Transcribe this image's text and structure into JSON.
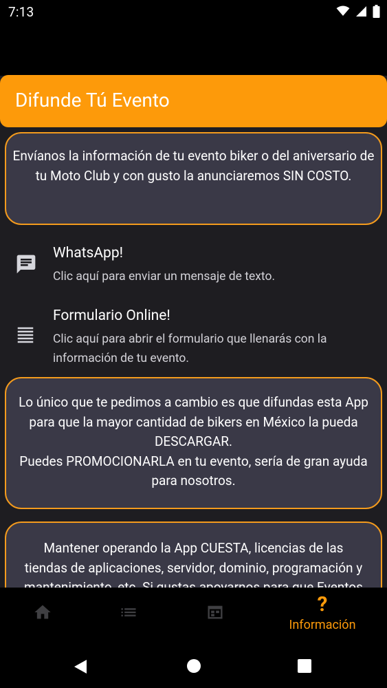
{
  "status_bar": {
    "time": "7:13",
    "icons": [
      "wifi-icon",
      "signal-icon",
      "battery-icon"
    ]
  },
  "header": {
    "title": "Difunde Tú Evento",
    "color": "#fd9a0a"
  },
  "intro_card": {
    "text": "Envíanos la información de tu evento biker o del aniversario de tu Moto Club y con gusto la anunciaremos SIN COSTO."
  },
  "contact_options": [
    {
      "icon": "message-icon",
      "title": "WhatsApp!",
      "subtitle": "Clic aquí para enviar un mensaje de texto."
    },
    {
      "icon": "form-lines-icon",
      "title": "Formulario Online!",
      "subtitle": "Clic aquí para abrir el formulario que llenarás con la información de tu evento."
    }
  ],
  "request_card": {
    "line1": "Lo único que te pedimos a cambio es que difundas esta App para que la mayor cantidad de bikers en México la pueda DESCARGAR.",
    "line2": "Puedes PROMOCIONARLA en tu evento, sería de gran ayuda para nosotros."
  },
  "support_card": {
    "line1": "Mantener operando la App CUESTA, licencias de las",
    "line2": "tiendas de aplicaciones, servidor, dominio, programación y",
    "line3": "mantenimiento, etc. Si gustas apoyarnos para que Eventos"
  },
  "bottom_nav": {
    "items": [
      {
        "icon": "home-icon",
        "label": ""
      },
      {
        "icon": "list-icon",
        "label": ""
      },
      {
        "icon": "calendar-icon",
        "label": ""
      },
      {
        "icon": "question-icon",
        "symbol": "?",
        "label": "Información",
        "active": true
      }
    ],
    "active_color": "#fd9a0a"
  },
  "system_nav": [
    "back-icon",
    "home-circle-icon",
    "recents-icon"
  ]
}
